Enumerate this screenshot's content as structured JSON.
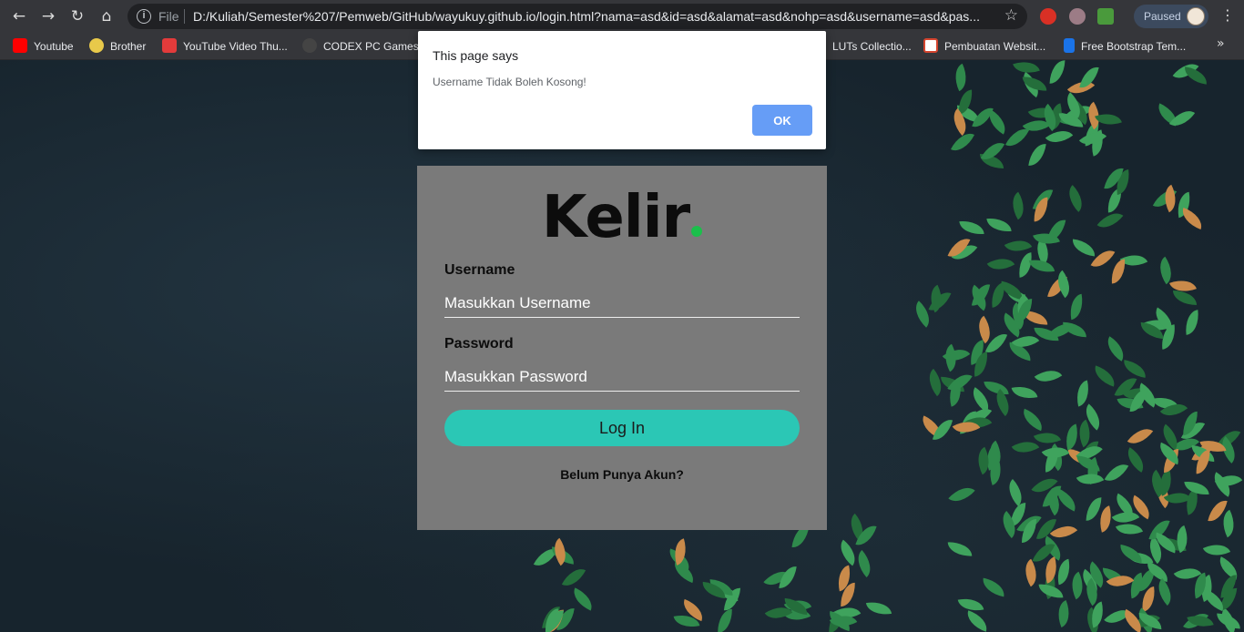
{
  "browser": {
    "url_scheme_label": "File",
    "url": "D:/Kuliah/Semester%207/Pemweb/GitHub/wayukuy.github.io/login.html?nama=asd&id=asd&alamat=asd&nohp=asd&username=asd&pas...",
    "profile_status": "Paused",
    "bookmarks": [
      {
        "label": "Youtube",
        "color": "#ff0000"
      },
      {
        "label": "Brother",
        "color": "#e8c94a"
      },
      {
        "label": "YouTube Video Thu...",
        "color": "#e33b3b"
      },
      {
        "label": "CODEX PC Games |...",
        "color": "#444444"
      },
      {
        "label": "LUTs Collectio...",
        "color": "#888888"
      },
      {
        "label": "Pembuatan Websit...",
        "color": "#d4442e"
      },
      {
        "label": "Free Bootstrap Tem...",
        "color": "#1a73e8"
      }
    ]
  },
  "login": {
    "brand": "Kelir",
    "brand_dot_color": "#1bbf4b",
    "username_label": "Username",
    "username_placeholder": "Masukkan Username",
    "password_label": "Password",
    "password_placeholder": "Masukkan Password",
    "login_button": "Log In",
    "signup_link": "Belum Punya Akun?",
    "button_color": "#2bc7b5"
  },
  "alert": {
    "title": "This page says",
    "message": "Username Tidak Boleh Kosong!",
    "ok_label": "OK"
  }
}
